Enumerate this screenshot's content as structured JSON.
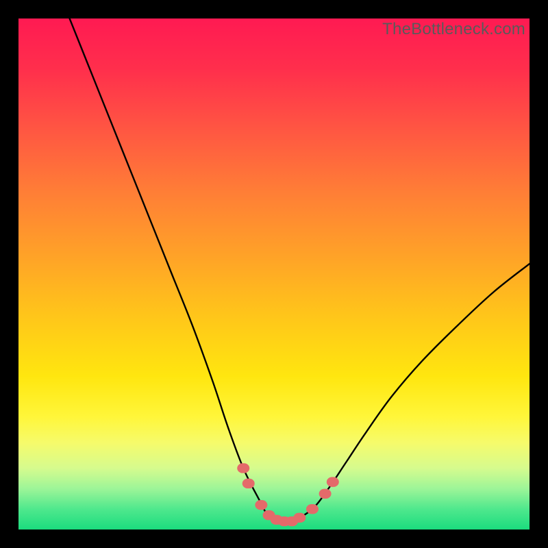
{
  "watermark": "TheBottleneck.com",
  "chart_data": {
    "type": "line",
    "title": "",
    "xlabel": "",
    "ylabel": "",
    "xlim": [
      0,
      100
    ],
    "ylim": [
      0,
      100
    ],
    "series": [
      {
        "name": "bottleneck-curve",
        "x": [
          10,
          14,
          18,
          22,
          26,
          30,
          34,
          38,
          41,
          44,
          47,
          49,
          51,
          53,
          55,
          58,
          61,
          64,
          68,
          73,
          79,
          86,
          93,
          100
        ],
        "y": [
          100,
          90,
          80,
          70,
          60,
          50,
          40,
          29,
          20,
          12,
          6,
          2.5,
          1.6,
          1.6,
          2.3,
          4.5,
          8.5,
          13,
          19,
          26,
          33,
          40,
          46.5,
          52
        ]
      }
    ],
    "markers": {
      "name": "highlight-dots",
      "color": "#e46a6a",
      "points": [
        {
          "x": 44.0,
          "y": 12.0
        },
        {
          "x": 45.0,
          "y": 9.0
        },
        {
          "x": 47.5,
          "y": 4.8
        },
        {
          "x": 49.0,
          "y": 2.8
        },
        {
          "x": 50.5,
          "y": 1.9
        },
        {
          "x": 52.0,
          "y": 1.6
        },
        {
          "x": 53.5,
          "y": 1.6
        },
        {
          "x": 55.0,
          "y": 2.3
        },
        {
          "x": 57.5,
          "y": 4.0
        },
        {
          "x": 60.0,
          "y": 7.0
        },
        {
          "x": 61.5,
          "y": 9.3
        }
      ]
    }
  }
}
